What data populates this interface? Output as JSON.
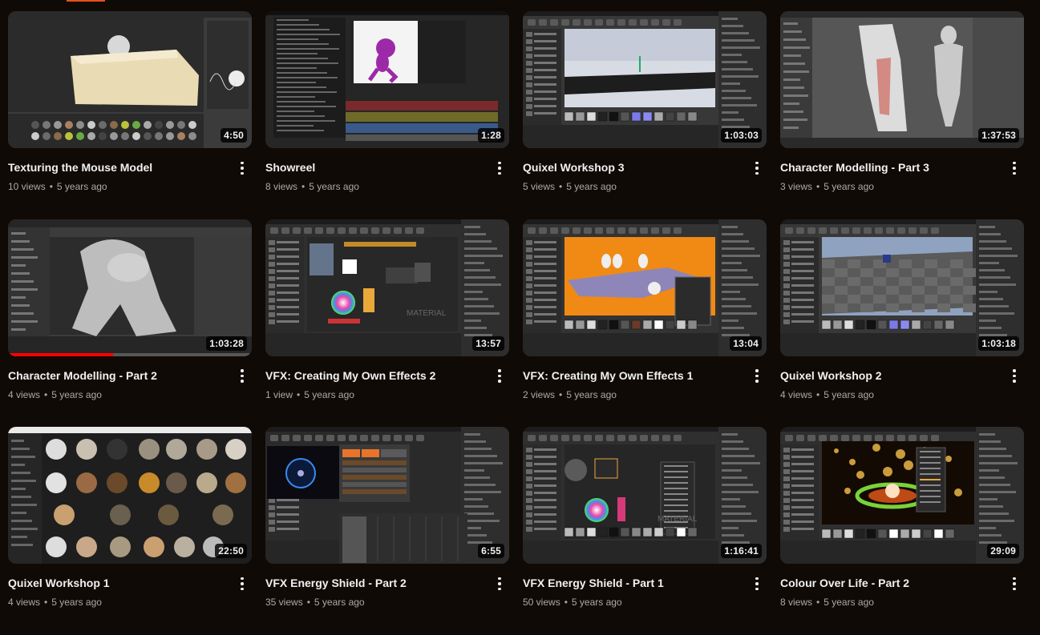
{
  "videos": [
    {
      "title": "Texturing the Mouse Model",
      "views": "10 views",
      "age": "5 years ago",
      "duration": "4:50",
      "thumb": "model"
    },
    {
      "title": "Showreel",
      "views": "8 views",
      "age": "5 years ago",
      "duration": "1:28",
      "thumb": "anim"
    },
    {
      "title": "Quixel Workshop 3",
      "views": "5 views",
      "age": "5 years ago",
      "duration": "1:03:03",
      "thumb": "ue-sky"
    },
    {
      "title": "Character Modelling - Part 3",
      "views": "3 views",
      "age": "5 years ago",
      "duration": "1:37:53",
      "thumb": "sculpt"
    },
    {
      "title": "Character Modelling - Part 2",
      "views": "4 views",
      "age": "5 years ago",
      "duration": "1:03:28",
      "thumb": "sculpt2",
      "watched_fraction": 0.43
    },
    {
      "title": "VFX: Creating My Own Effects 2",
      "views": "1 view",
      "age": "5 years ago",
      "duration": "13:57",
      "thumb": "material"
    },
    {
      "title": "VFX: Creating My Own Effects 1",
      "views": "2 views",
      "age": "5 years ago",
      "duration": "13:04",
      "thumb": "orange"
    },
    {
      "title": "Quixel Workshop 2",
      "views": "4 views",
      "age": "5 years ago",
      "duration": "1:03:18",
      "thumb": "checker"
    },
    {
      "title": "Quixel Workshop 1",
      "views": "4 views",
      "age": "5 years ago",
      "duration": "22:50",
      "thumb": "assets"
    },
    {
      "title": "VFX Energy Shield - Part 2",
      "views": "35 views",
      "age": "5 years ago",
      "duration": "6:55",
      "thumb": "niagara"
    },
    {
      "title": "VFX Energy Shield - Part 1",
      "views": "50 views",
      "age": "5 years ago",
      "duration": "1:16:41",
      "thumb": "material2"
    },
    {
      "title": "Colour Over Life - Part 2",
      "views": "8 views",
      "age": "5 years ago",
      "duration": "29:09",
      "thumb": "particles"
    }
  ],
  "colors": {
    "background": "#100a06",
    "title": "#f1f1f1",
    "meta": "#aaaaaa",
    "progress": "#ff0000"
  }
}
